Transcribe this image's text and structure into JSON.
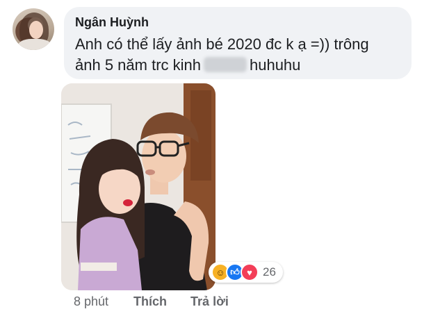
{
  "comment": {
    "author": "Ngân Huỳnh",
    "text_line1": "Anh có thể lấy ảnh bé 2020 đc k ạ =)) trông",
    "text_line2_before": "ảnh 5 năm trc kinh",
    "text_line2_after": "huhuhu"
  },
  "reactions": {
    "icons": [
      "haha-icon",
      "like-icon",
      "love-icon"
    ],
    "count": "26"
  },
  "actions": {
    "time": "8 phút",
    "like_label": "Thích",
    "reply_label": "Trả lời"
  },
  "colors": {
    "bubble_bg": "#f0f2f5",
    "meta_text": "#65676b",
    "like_blue": "#1877f2",
    "love_red": "#f33e58",
    "haha_yellow": "#f7b125"
  }
}
